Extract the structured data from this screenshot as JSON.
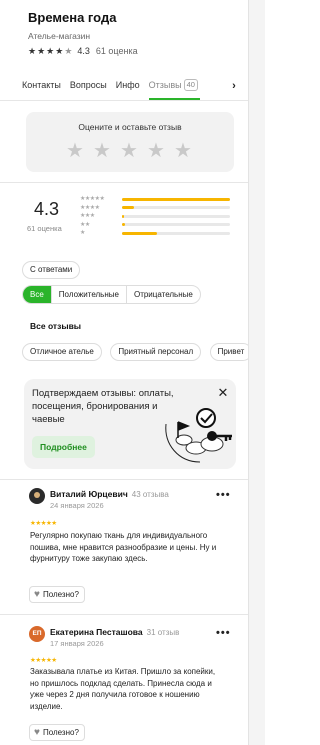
{
  "header": {
    "title": "Времена года",
    "subtitle": "Ателье-магазин",
    "rating_value": "4.3",
    "ratings_count": "61 оценка",
    "rating_stars": 4.3
  },
  "tabs": [
    {
      "label": "Контакты",
      "badge": ""
    },
    {
      "label": "Вопросы",
      "badge": ""
    },
    {
      "label": "Инфо",
      "badge": ""
    },
    {
      "label": "Отзывы",
      "badge": "40",
      "active": true
    }
  ],
  "tabs_next_icon": "chevron-right-icon",
  "rate_prompt": {
    "title": "Оцените и оставьте отзыв",
    "star_count": 5
  },
  "summary": {
    "rating": "4.3",
    "count": "61 оценка",
    "distribution": [
      {
        "stars": 5,
        "fraction": 1.0
      },
      {
        "stars": 4,
        "fraction": 0.11
      },
      {
        "stars": 3,
        "fraction": 0.02
      },
      {
        "stars": 2,
        "fraction": 0.03
      },
      {
        "stars": 1,
        "fraction": 0.32
      }
    ]
  },
  "filters": {
    "with_answers": "С ответами",
    "segments": [
      {
        "label": "Все",
        "active": true
      },
      {
        "label": "Положительные",
        "active": false
      },
      {
        "label": "Отрицательные",
        "active": false
      }
    ]
  },
  "all_reviews_label": "Все отзывы",
  "tags": [
    "Отличное ателье",
    "Приятный персонал",
    "Привет"
  ],
  "promo": {
    "text": "Подтверждаем отзывы: оплаты, посещения, бронирования и чаевые",
    "button": "Подробнее",
    "close_icon": "close-icon"
  },
  "reviews": [
    {
      "initials": "",
      "avatar_color": "#2b2b2b",
      "name": "Виталий Юрцевич",
      "count": "43 отзыва",
      "date": "24 января 2026",
      "stars": 5,
      "text": "Регулярно покупаю ткань для индивидуального пошива, мне нравится разнообразие и цены. Ну и фурнитуру тоже закупаю здесь.",
      "useful": "Полезно?"
    },
    {
      "initials": "ЕП",
      "avatar_color": "#d9692b",
      "name": "Екатерина Песташова",
      "count": "31 отзыв",
      "date": "17 января 2026",
      "stars": 5,
      "text": "Заказывала платье из Китая. Пришло за копейки, но пришлось подклад сделать. Принесла сюда и уже через 2 дня получила готовое к ношению изделие.",
      "useful": "Полезно?"
    }
  ],
  "colors": {
    "accent_green": "#2ab42a",
    "star_gold": "#f7b500"
  }
}
